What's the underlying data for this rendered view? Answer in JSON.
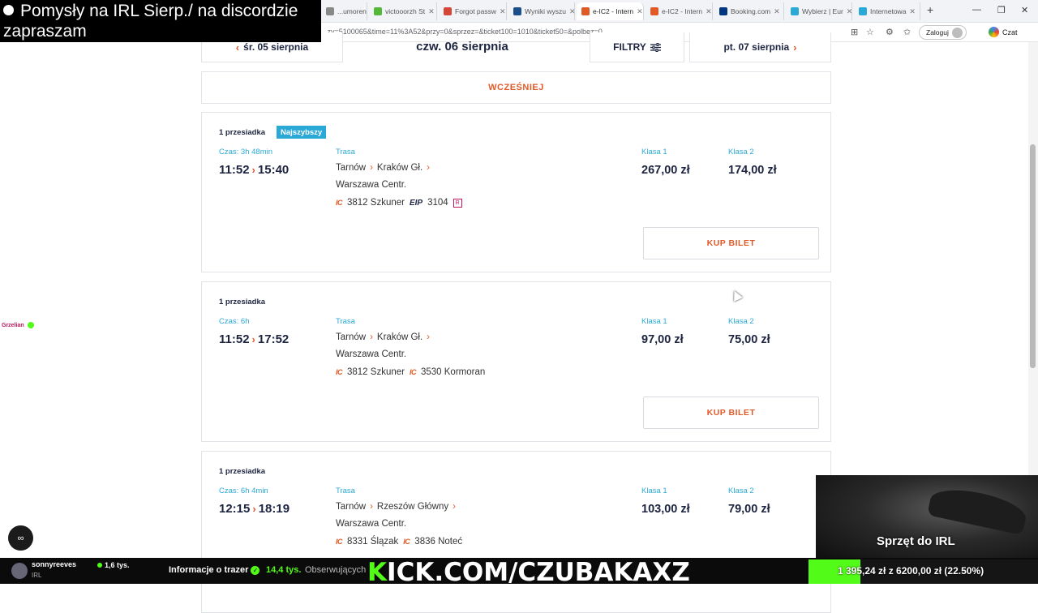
{
  "overlay": {
    "title_line1": "Pomysły na IRL Sierp./ na discordzie",
    "title_line2": "zapraszam"
  },
  "browser": {
    "tabs": [
      {
        "label": "...umorena",
        "color": "#888"
      },
      {
        "label": "victooorzh St",
        "color": "#53b83a"
      },
      {
        "label": "Forgot passw",
        "color": "#d44638"
      },
      {
        "label": "Wyniki wyszu",
        "color": "#1a4f8b"
      },
      {
        "label": "e-IC2 - Intern",
        "color": "#e05a28"
      },
      {
        "label": "e-IC2 - Intern",
        "color": "#e05a28"
      },
      {
        "label": "Booking.com",
        "color": "#003580"
      },
      {
        "label": "Wybierz | Eur",
        "color": "#2aa9d6"
      },
      {
        "label": "Internetowa",
        "color": "#2aa9d6"
      }
    ],
    "url": "...zy=5100065&time=11%3A52&przy=0&sprzez=&ticket100=1010&ticket50=&polbez=0",
    "login_label": "Zaloguj",
    "chat_label": "Czat"
  },
  "datebar": {
    "prev": "śr. 05 sierpnia",
    "current": "czw. 06 sierpnia",
    "filters": "FILTRY",
    "next": "pt. 07 sierpnia"
  },
  "earlier_label": "WCZEŚNIEJ",
  "labels": {
    "route": "Trasa",
    "class1": "Klasa 1",
    "class2": "Klasa 2",
    "buy": "KUP BILET"
  },
  "connections": [
    {
      "transfers": "1 przesiadka",
      "badge": "Najszybszy",
      "duration": "Czas: 3h 48min",
      "depart": "11:52",
      "arrive": "15:40",
      "route": [
        "Tarnów",
        "Kraków Gł.",
        "Warszawa Centr."
      ],
      "trains": [
        {
          "carrier": "IC",
          "name": "3812 Szkuner"
        },
        {
          "carrier": "EIP",
          "name": "3104",
          "reservation": "R"
        }
      ],
      "price1": "267,00 zł",
      "price2": "174,00 zł"
    },
    {
      "transfers": "1 przesiadka",
      "badge": "",
      "duration": "Czas: 6h",
      "depart": "11:52",
      "arrive": "17:52",
      "route": [
        "Tarnów",
        "Kraków Gł.",
        "Warszawa Centr."
      ],
      "trains": [
        {
          "carrier": "IC",
          "name": "3812 Szkuner"
        },
        {
          "carrier": "IC",
          "name": "3530 Kormoran"
        }
      ],
      "price1": "97,00 zł",
      "price2": "75,00 zł"
    },
    {
      "transfers": "1 przesiadka",
      "badge": "",
      "duration": "Czas: 6h 4min",
      "depart": "12:15",
      "arrive": "18:19",
      "route": [
        "Tarnów",
        "Rzeszów Główny",
        "Warszawa Centr."
      ],
      "trains": [
        {
          "carrier": "IC",
          "name": "8331 Ślązak"
        },
        {
          "carrier": "IC",
          "name": "3836 Noteć"
        }
      ],
      "price1": "103,00 zł",
      "price2": "79,00 zł"
    }
  ],
  "side_chat": {
    "name": "Grzelian"
  },
  "stream": {
    "streamer": "sonnyreeves",
    "category": "IRL",
    "viewers": "1,6 tys.",
    "info_label": "Informacje o trazer",
    "followers": "14,4 tys.",
    "followers_label": "Obserwujących",
    "brand_k": "K",
    "brand_rest": "ICK.COM/CZUBAKAXZ",
    "goal_text": "1 395,24 zł z 6200,00 zł (22.50%)",
    "goal_fraction": 0.225,
    "cam_label": "Sprzęt do IRL",
    "accent": "#53fc18"
  }
}
